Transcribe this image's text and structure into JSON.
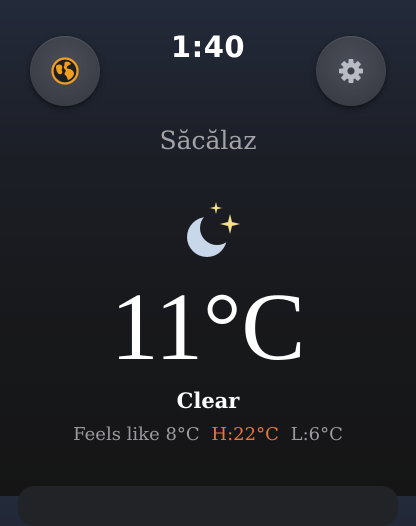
{
  "header": {
    "time": "1:40",
    "globe_icon": "globe-icon",
    "settings_icon": "gear-icon"
  },
  "location": {
    "city": "Săcălaz"
  },
  "current": {
    "icon": "moon-stars-icon",
    "temperature": "11°C",
    "condition": "Clear",
    "feels_like": "Feels like 8°C",
    "high": "H:22°C",
    "low": "L:6°C"
  },
  "colors": {
    "accent_orange": "#f0a020",
    "high_temp": "#e8763c",
    "moon": "#c9d7ea",
    "stars": "#f5e08a"
  }
}
